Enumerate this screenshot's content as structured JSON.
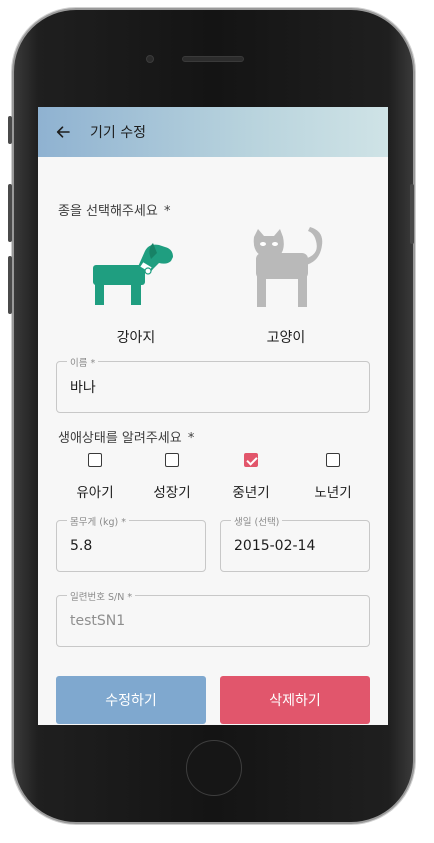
{
  "header": {
    "title": "기기 수정"
  },
  "species": {
    "label": "종을 선택해주세요",
    "required_mark": "*",
    "options": [
      {
        "name": "강아지",
        "selected": true,
        "icon": "dog-icon",
        "color": "#1f9e80"
      },
      {
        "name": "고양이",
        "selected": false,
        "icon": "cat-icon",
        "color": "#b9b9b9"
      }
    ]
  },
  "name_field": {
    "label": "이름 *",
    "value": "바나"
  },
  "life_stage": {
    "label": "생애상태를 알려주세요",
    "required_mark": "*",
    "options": [
      {
        "label": "유아기",
        "checked": false
      },
      {
        "label": "성장기",
        "checked": false
      },
      {
        "label": "중년기",
        "checked": true
      },
      {
        "label": "노년기",
        "checked": false
      }
    ]
  },
  "weight_field": {
    "label": "몸무게 (kg) *",
    "value": "5.8"
  },
  "birth_field": {
    "label": "생일 (선택)",
    "value": "2015-02-14"
  },
  "serial_field": {
    "label": "일련번호 S/N *",
    "value": "testSN1",
    "disabled": true
  },
  "actions": {
    "edit_label": "수정하기",
    "delete_label": "삭제하기"
  },
  "colors": {
    "primary": "#7fa8cf",
    "danger": "#e1566c",
    "accent_green": "#1f9e80",
    "check_pink": "#e2566b"
  }
}
